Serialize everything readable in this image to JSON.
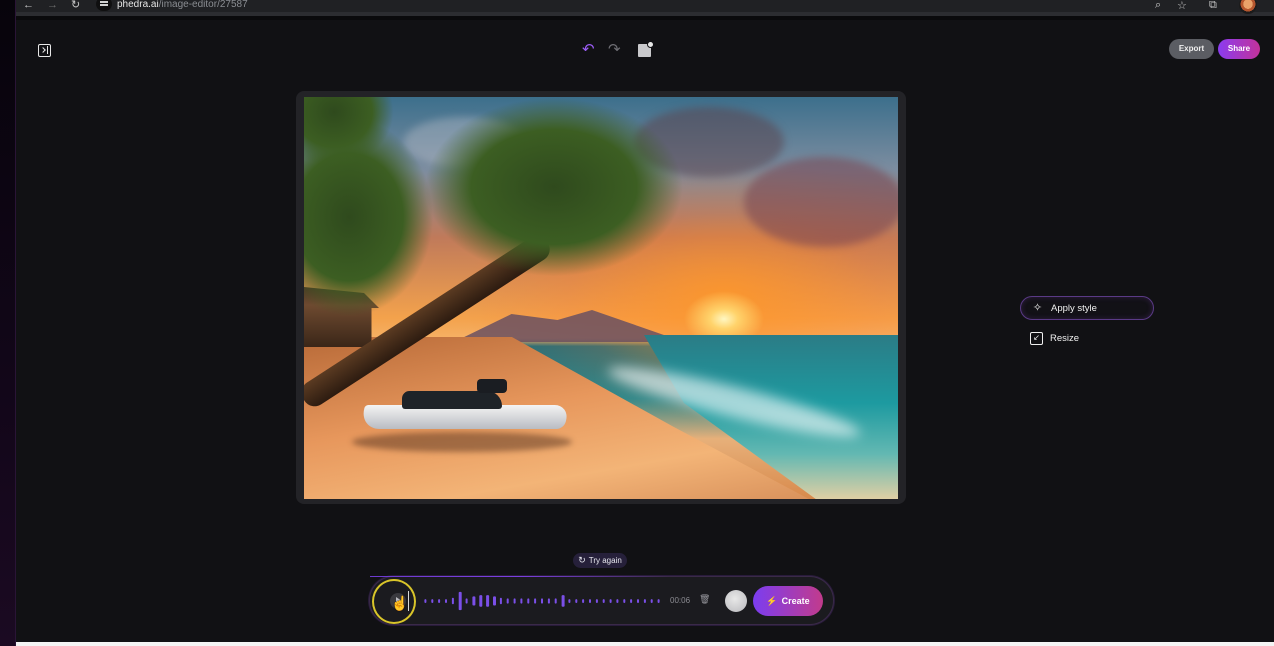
{
  "browser": {
    "back_icon": "←",
    "forward_icon": "→",
    "reload_icon": "↻",
    "url_host": "phedra.ai",
    "url_path": "/image-editor/27587",
    "zoom_icon": "⌕",
    "star_icon": "☆",
    "extensions_icon": "⧉"
  },
  "toolbar": {
    "undo_icon": "↶",
    "redo_icon": "↷",
    "export_label": "Export",
    "share_label": "Share"
  },
  "canvas": {
    "image_description": "Tropical beach at sunset with leaning palm trees, a hut, and a white jet ski on the sand"
  },
  "tools": [
    {
      "label": "Apply style",
      "icon": "sparkles-icon",
      "glyph": "✧",
      "active": true
    },
    {
      "label": "Resize",
      "icon": "resize-icon",
      "glyph": "↙",
      "active": false
    }
  ],
  "prompt": {
    "try_again_icon": "↻",
    "try_again_label": "Try again",
    "duration": "00:06",
    "trash_icon": "🗑",
    "create_icon": "⚡",
    "create_label": "Create",
    "hand_cursor": "☝",
    "waveform_levels": [
      0.15,
      0.15,
      0.15,
      0.15,
      0.25,
      0.7,
      0.2,
      0.35,
      0.45,
      0.45,
      0.35,
      0.25,
      0.2,
      0.2,
      0.2,
      0.2,
      0.2,
      0.2,
      0.2,
      0.2,
      0.45,
      0.15,
      0.15,
      0.15,
      0.15,
      0.15,
      0.15,
      0.15,
      0.15,
      0.15,
      0.15,
      0.15,
      0.15,
      0.15,
      0.15
    ],
    "waveform_color": "#7b4fe8"
  },
  "colors": {
    "accent_purple": "#8b3cf0",
    "accent_pink": "#c2329a",
    "background": "#111114"
  }
}
